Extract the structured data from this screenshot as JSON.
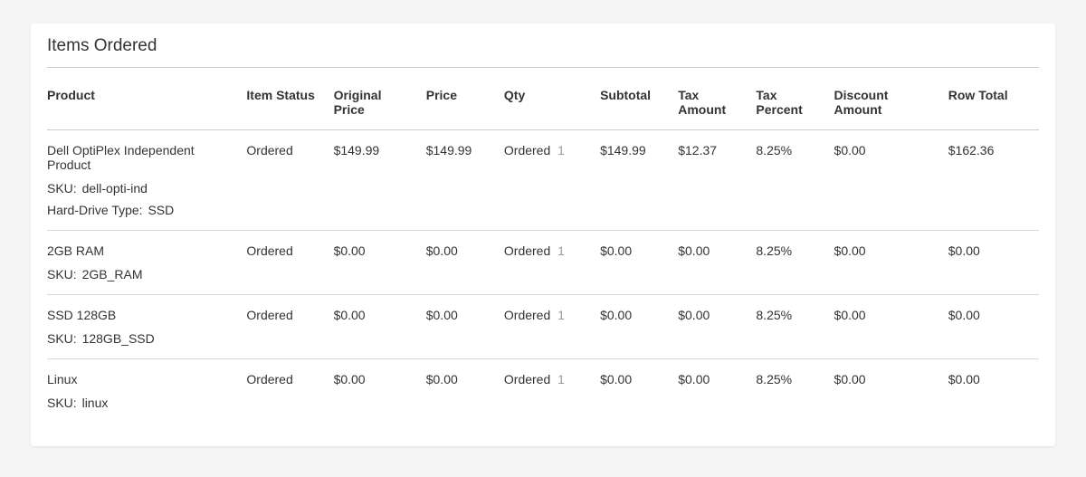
{
  "section": {
    "title": "Items Ordered"
  },
  "columns": {
    "product": "Product",
    "item_status": "Item Status",
    "original_price": "Original Price",
    "price": "Price",
    "qty": "Qty",
    "subtotal": "Subtotal",
    "tax_amount": "Tax Amount",
    "tax_percent": "Tax Percent",
    "discount_amount": "Discount Amount",
    "row_total": "Row Total"
  },
  "labels": {
    "sku": "SKU:",
    "hard_drive_type": "Hard-Drive Type:",
    "qty_ordered": "Ordered"
  },
  "items": [
    {
      "name": "Dell OptiPlex Independent Product",
      "sku": "dell-opti-ind",
      "hard_drive_type": "SSD",
      "status": "Ordered",
      "original_price": "$149.99",
      "price": "$149.99",
      "qty_ordered": "1",
      "subtotal": "$149.99",
      "tax_amount": "$12.37",
      "tax_percent": "8.25%",
      "discount_amount": "$0.00",
      "row_total": "$162.36"
    },
    {
      "name": "2GB RAM",
      "sku": "2GB_RAM",
      "status": "Ordered",
      "original_price": "$0.00",
      "price": "$0.00",
      "qty_ordered": "1",
      "subtotal": "$0.00",
      "tax_amount": "$0.00",
      "tax_percent": "8.25%",
      "discount_amount": "$0.00",
      "row_total": "$0.00"
    },
    {
      "name": "SSD 128GB",
      "sku": "128GB_SSD",
      "status": "Ordered",
      "original_price": "$0.00",
      "price": "$0.00",
      "qty_ordered": "1",
      "subtotal": "$0.00",
      "tax_amount": "$0.00",
      "tax_percent": "8.25%",
      "discount_amount": "$0.00",
      "row_total": "$0.00"
    },
    {
      "name": "Linux",
      "sku": "linux",
      "status": "Ordered",
      "original_price": "$0.00",
      "price": "$0.00",
      "qty_ordered": "1",
      "subtotal": "$0.00",
      "tax_amount": "$0.00",
      "tax_percent": "8.25%",
      "discount_amount": "$0.00",
      "row_total": "$0.00"
    }
  ]
}
